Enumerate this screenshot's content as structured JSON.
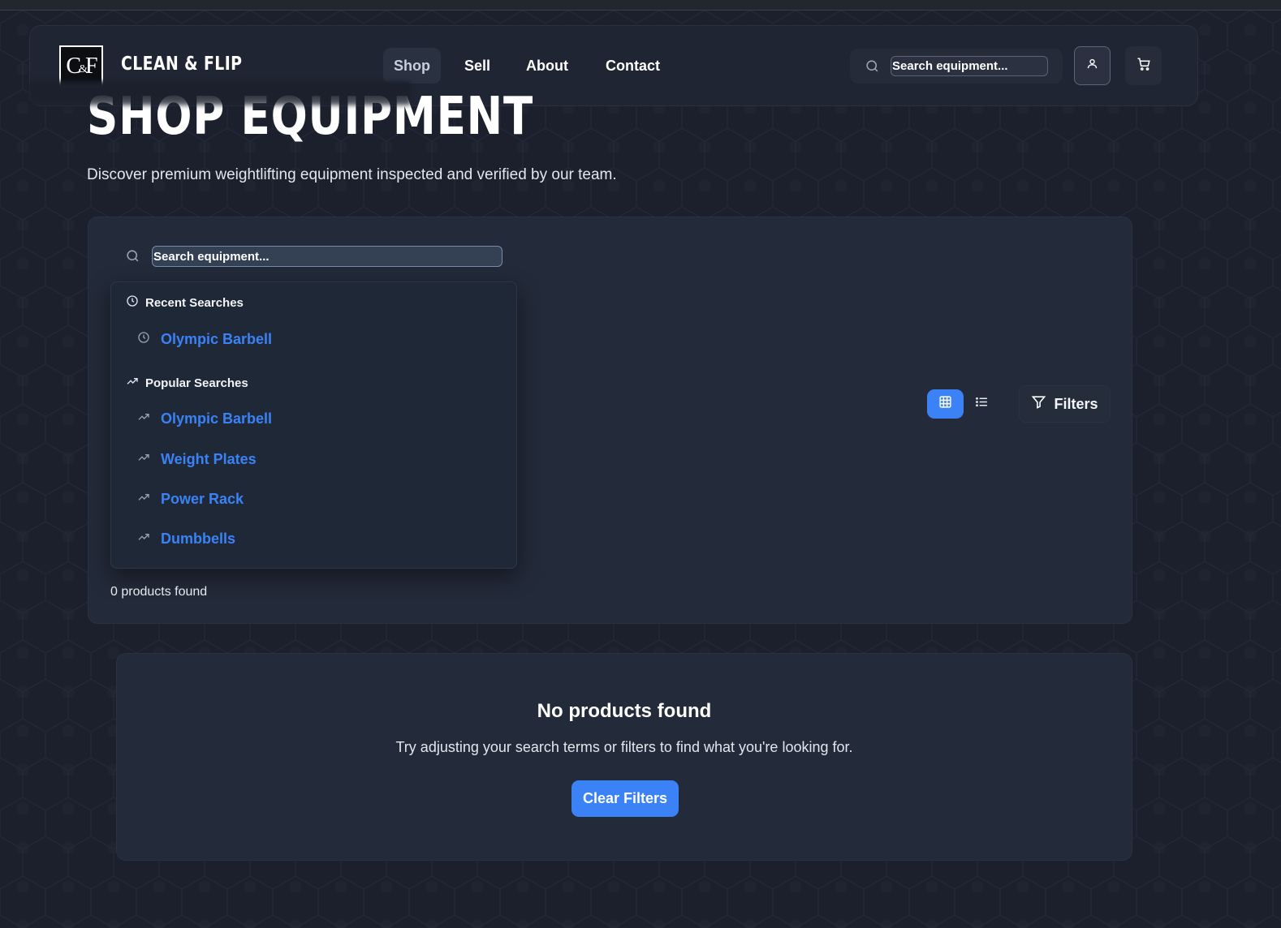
{
  "brand": {
    "logo_text": "C&F",
    "logo_main_left": "C",
    "logo_amp": "&",
    "logo_main_right": "F",
    "name": "CLEAN & FLIP"
  },
  "nav": {
    "items": [
      {
        "label": "Shop",
        "active": true
      },
      {
        "label": "Sell",
        "active": false
      },
      {
        "label": "About",
        "active": false
      },
      {
        "label": "Contact",
        "active": false
      }
    ]
  },
  "header_search": {
    "placeholder": "Search equipment..."
  },
  "icons": {
    "search": "search-icon",
    "user": "user-icon",
    "cart": "cart-icon",
    "clock": "clock-icon",
    "trending": "trending-up-icon",
    "grid": "grid-icon",
    "list": "list-icon",
    "filter": "filter-icon"
  },
  "page": {
    "title": "SHOP EQUIPMENT",
    "subtitle": "Discover premium weightlifting equipment inspected and verified by our team."
  },
  "panel": {
    "search_placeholder": "Search equipment...",
    "recent_heading": "Recent Searches",
    "recent": [
      "Olympic Barbell"
    ],
    "popular_heading": "Popular Searches",
    "popular": [
      "Olympic Barbell",
      "Weight Plates",
      "Power Rack",
      "Dumbbells"
    ],
    "filters_label": "Filters",
    "view_mode": "grid",
    "result_count": "0 products found"
  },
  "empty_state": {
    "title": "No products found",
    "message": "Try adjusting your search terms or filters to find what you're looking for.",
    "button": "Clear Filters"
  },
  "colors": {
    "accent": "#3b82f6",
    "background": "#1b202c",
    "panel": "#232a39"
  }
}
